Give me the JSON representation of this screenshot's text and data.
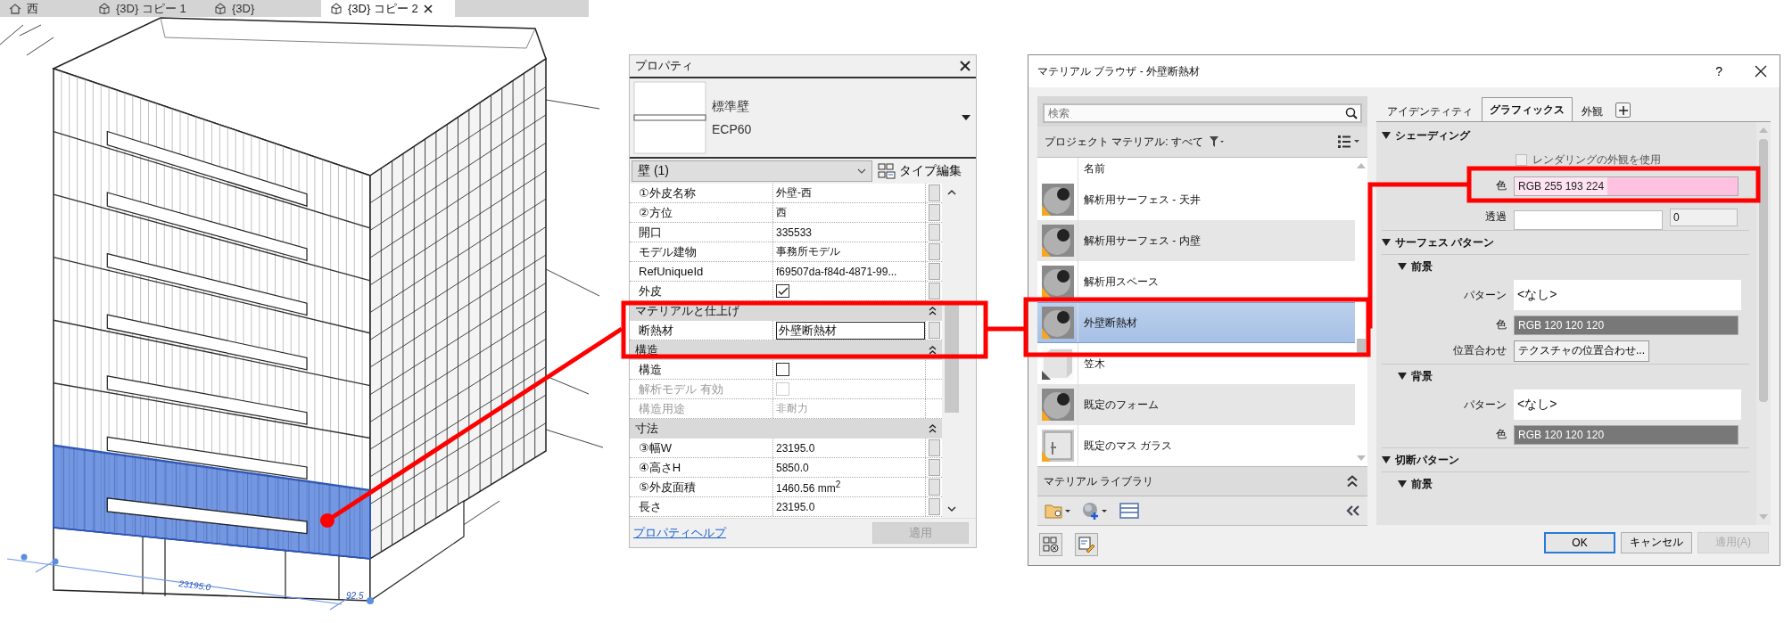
{
  "view_tabs": [
    {
      "label": "西",
      "kind": "elevation",
      "selected": false
    },
    {
      "label": "{3D} コピー 1",
      "kind": "perspective",
      "selected": false
    },
    {
      "label": "{3D}",
      "kind": "perspective",
      "selected": false
    },
    {
      "label": "{3D} コピー 2",
      "kind": "perspective",
      "selected": true
    }
  ],
  "view": {
    "dimension_labels": [
      "23195.0",
      "92.5"
    ]
  },
  "properties": {
    "title": "プロパティ",
    "type_name": "標準壁",
    "type_detail": "ECP60",
    "instance_filter": "壁 (1)",
    "edit_type_button": "タイプ編集",
    "groups": [
      {
        "rows": [
          {
            "label": "①外皮名称",
            "kind": "text",
            "value": "外壁-西",
            "disabled": false,
            "link_button": true
          },
          {
            "label": "②方位",
            "kind": "text",
            "value": "西",
            "disabled": false,
            "link_button": true
          },
          {
            "label": "開口",
            "kind": "text",
            "value": "335533",
            "disabled": false,
            "link_button": true
          },
          {
            "label": "モデル建物",
            "kind": "text",
            "value": "事務所モデル",
            "disabled": false,
            "link_button": true
          },
          {
            "label": "RefUniqueId",
            "kind": "text",
            "value": "f69507da-f84d-4871-99...",
            "disabled": false,
            "link_button": true
          },
          {
            "label": "外皮",
            "kind": "checkbox",
            "checked": true,
            "disabled": false,
            "link_button": true
          }
        ]
      },
      {
        "title": "マテリアルと仕上げ",
        "rows": [
          {
            "label": "断熱材",
            "kind": "edit",
            "value": "外壁断熱材",
            "disabled": false,
            "link_button": true
          }
        ]
      },
      {
        "title": "構造",
        "rows": [
          {
            "label": "構造",
            "kind": "checkbox",
            "checked": false,
            "disabled": false,
            "link_button": false
          },
          {
            "label": "解析モデル 有効",
            "kind": "checkbox",
            "checked": false,
            "disabled": true,
            "link_button": false
          },
          {
            "label": "構造用途",
            "kind": "text",
            "value": "非耐力",
            "disabled": true,
            "link_button": false
          }
        ]
      },
      {
        "title": "寸法",
        "rows": [
          {
            "label": "③幅W",
            "kind": "text",
            "value": "23195.0",
            "disabled": false,
            "link_button": true
          },
          {
            "label": "④高さH",
            "kind": "text",
            "value": "5850.0",
            "disabled": false,
            "link_button": true
          },
          {
            "label": "⑤外皮面積",
            "kind": "text",
            "value": "1460.56 mm$^{2}$",
            "disabled": false,
            "link_button": true
          },
          {
            "label": "長さ",
            "kind": "text",
            "value": "23195.0",
            "disabled": false,
            "link_button": true
          }
        ]
      }
    ],
    "help_link": "プロパティヘルプ",
    "apply_button": {
      "label": "適用",
      "disabled": true
    }
  },
  "material_browser": {
    "title": "マテリアル ブラウザ - 外壁断熱材",
    "help_label": "?",
    "search": {
      "placeholder": "検索"
    },
    "filter_label": "プロジェクト マテリアル: すべて",
    "column_header": "名前",
    "materials": [
      {
        "name": "解析用サーフェス - 天井",
        "kind": "sphere",
        "selected": false
      },
      {
        "name": "解析用サーフェス - 内壁",
        "kind": "sphere",
        "selected": false
      },
      {
        "name": "解析用スペース",
        "kind": "sphere",
        "selected": false
      },
      {
        "name": "外壁断熱材",
        "kind": "sphere",
        "selected": true
      },
      {
        "name": "笠木",
        "kind": "cube",
        "selected": false
      },
      {
        "name": "既定のフォーム",
        "kind": "sphere",
        "selected": false
      },
      {
        "name": "既定のマス ガラス",
        "kind": "glass",
        "selected": false
      }
    ],
    "library_label": "マテリアル ライブラリ",
    "tabs": [
      {
        "label": "アイデンティティ",
        "selected": false
      },
      {
        "label": "グラフィックス",
        "selected": true
      },
      {
        "label": "外観",
        "selected": false
      }
    ],
    "sections": [
      {
        "title": "シェーディング",
        "items": [
          {
            "kind": "checkbox",
            "label": "レンダリングの外観を使用",
            "checked": false
          },
          {
            "kind": "color",
            "label": "色",
            "value": "RGB 255 193 224",
            "color": "#ffc1e0"
          },
          {
            "kind": "transparency",
            "label": "透過",
            "value": "0"
          }
        ]
      },
      {
        "title": "サーフェス パターン",
        "subsections": [
          {
            "title": "前景",
            "items": [
              {
                "kind": "pattern",
                "label": "パターン",
                "value": "<なし>"
              },
              {
                "kind": "color",
                "label": "色",
                "value": "RGB 120 120 120",
                "color": "#787878"
              },
              {
                "kind": "button",
                "label": "位置合わせ",
                "value": "テクスチャの位置合わせ..."
              }
            ]
          },
          {
            "title": "背景",
            "items": [
              {
                "kind": "pattern",
                "label": "パターン",
                "value": "<なし>"
              },
              {
                "kind": "color",
                "label": "色",
                "value": "RGB 120 120 120",
                "color": "#787878"
              }
            ]
          }
        ]
      },
      {
        "title": "切断パターン",
        "subsections": [
          {
            "title": "前景"
          }
        ]
      }
    ],
    "buttons": [
      {
        "label": "OK",
        "kind": "default",
        "disabled": false
      },
      {
        "label": "キャンセル",
        "kind": "normal",
        "disabled": false
      },
      {
        "label": "適用(A)",
        "kind": "normal",
        "disabled": true
      }
    ]
  }
}
